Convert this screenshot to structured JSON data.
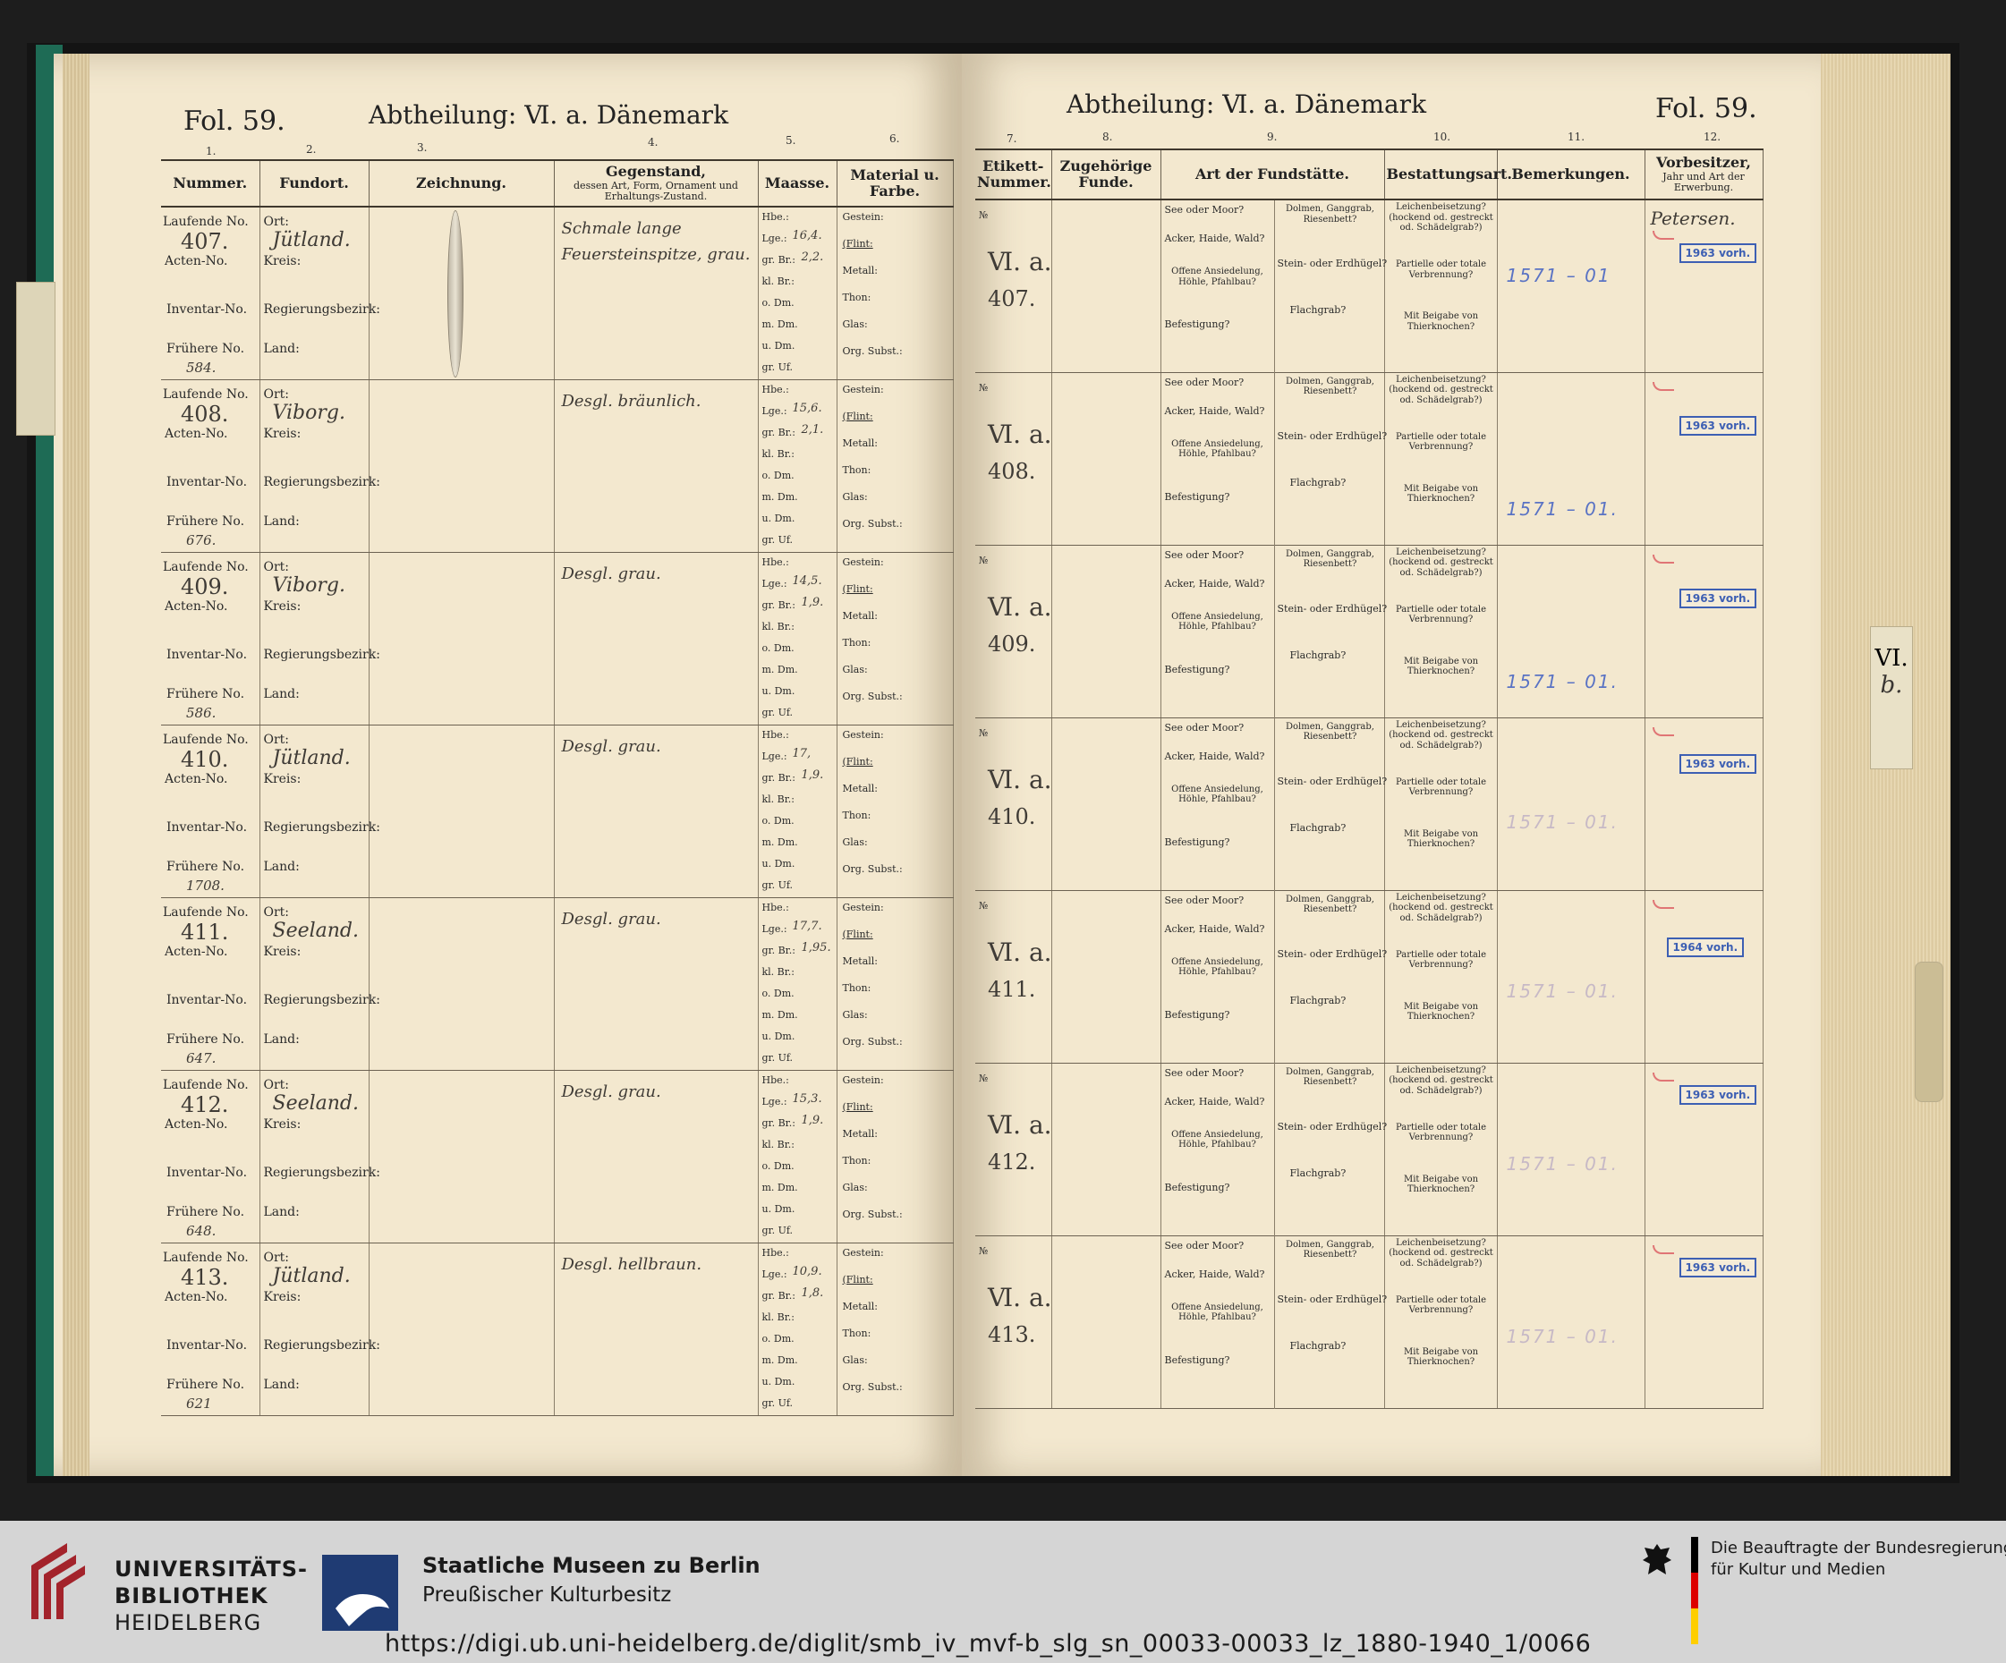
{
  "header": {
    "left_fol": "Fol. 59.",
    "right_fol": "Fol. 59.",
    "left_abth": "Abtheilung: Ⅵ. a. Dänemark",
    "right_abth": "Abtheilung: Ⅵ. a. Dänemark"
  },
  "left_columns": {
    "nums": [
      "1.",
      "2.",
      "3.",
      "4.",
      "5.",
      "6."
    ],
    "nummer": "Nummer.",
    "fundort": "Fundort.",
    "zeichnung": "Zeichnung.",
    "gegenstand": "Gegenstand,",
    "gegenstand_sub": "dessen Art, Form, Ornament und Erhaltungs-Zustand.",
    "maasse": "Maasse.",
    "material": "Material u. Farbe."
  },
  "right_columns": {
    "nums": [
      "7.",
      "8.",
      "9.",
      "10.",
      "11.",
      "12."
    ],
    "etikett": "Etikett-Nummer.",
    "zugehoerige": "Zugehörige Funde.",
    "art": "Art der Fundstätte.",
    "bestattung": "Bestattungsart.",
    "bemerkungen": "Bemerkungen.",
    "vorbesitzer": "Vorbesitzer,",
    "vorbesitzer_sub": "Jahr und Art der Erwerbung."
  },
  "labels": {
    "laufende": "Laufende No.",
    "acten": "Acten-No.",
    "inventar": "Inventar-No.",
    "fruehere": "Frühere No.",
    "ort": "Ort:",
    "kreis": "Kreis:",
    "regierungsbezirk": "Regierungsbezirk:",
    "land": "Land:",
    "hbe": "Hbe.:",
    "lge": "Lge.:",
    "grbr": "gr. Br.:",
    "klbr": "kl. Br.:",
    "odm": "o. Dm.",
    "mdm": "m. Dm.",
    "udm": "u. Dm.",
    "gruf": "gr. Uf.",
    "gestein": "Gestein:",
    "flint": "(Flint:",
    "metall": "Metall:",
    "thon": "Thon:",
    "glas": "Glas:",
    "org": "Org. Subst.:",
    "no": "№",
    "see": "See oder Moor?",
    "acker": "Acker, Haide, Wald?",
    "offene": "Offene Ansiedelung, Höhle, Pfahlbau?",
    "befestigung": "Befestigung?",
    "dolmen": "Dolmen, Ganggrab, Riesenbett?",
    "stein": "Stein- oder Erdhügel?",
    "flachgrab": "Flachgrab?",
    "leichen": "Leichenbeisetzung? (hockend od. gestreckt od. Schädelgrab?)",
    "partielle": "Partielle oder totale Verbrennung?",
    "beigabe": "Mit Beigabe von Thierknochen?"
  },
  "rows": [
    {
      "laufende": "407.",
      "fruehere": "584.",
      "ort": "Jütland.",
      "gegenstand": "Schmale lange Feuersteinspitze, grau.",
      "lge": "16,4.",
      "grbr": "2,2.",
      "etikett_a": "Ⅵ. a.",
      "etikett_b": "407.",
      "pencil": "1571 – 01",
      "stamp": "1963 vorh.",
      "vorbesitzer": "Petersen."
    },
    {
      "laufende": "408.",
      "fruehere": "676.",
      "ort": "Viborg.",
      "gegenstand": "Desgl. bräunlich.",
      "lge": "15,6.",
      "grbr": "2,1.",
      "etikett_a": "Ⅵ. a.",
      "etikett_b": "408.",
      "pencil": "1571 – 01.",
      "stamp": "1963 vorh.",
      "vorbesitzer": ""
    },
    {
      "laufende": "409.",
      "fruehere": "586.",
      "ort": "Viborg.",
      "gegenstand": "Desgl. grau.",
      "lge": "14,5.",
      "grbr": "1,9.",
      "etikett_a": "Ⅵ. a.",
      "etikett_b": "409.",
      "pencil": "1571 – 01.",
      "stamp": "1963 vorh.",
      "vorbesitzer": ""
    },
    {
      "laufende": "410.",
      "fruehere": "1708.",
      "ort": "Jütland.",
      "gegenstand": "Desgl. grau.",
      "lge": "17,",
      "grbr": "1,9.",
      "etikett_a": "Ⅵ. a.",
      "etikett_b": "410.",
      "pencil": "1571 – 01.",
      "stamp": "1963 vorh.",
      "vorbesitzer": ""
    },
    {
      "laufende": "411.",
      "fruehere": "647.",
      "ort": "Seeland.",
      "gegenstand": "Desgl. grau.",
      "lge": "17,7.",
      "grbr": "1,95.",
      "etikett_a": "Ⅵ. a.",
      "etikett_b": "411.",
      "pencil": "1571 – 01.",
      "stamp": "1964 vorh.",
      "vorbesitzer": ""
    },
    {
      "laufende": "412.",
      "fruehere": "648.",
      "ort": "Seeland.",
      "gegenstand": "Desgl. grau.",
      "lge": "15,3.",
      "grbr": "1,9.",
      "etikett_a": "Ⅵ. a.",
      "etikett_b": "412.",
      "pencil": "1571 – 01.",
      "stamp": "1963 vorh.",
      "vorbesitzer": ""
    },
    {
      "laufende": "413.",
      "fruehere": "621",
      "ort": "Jütland.",
      "gegenstand": "Desgl. hellbraun.",
      "lge": "10,9.",
      "grbr": "1,8.",
      "etikett_a": "Ⅵ. a.",
      "etikett_b": "413.",
      "pencil": "1571 – 01.",
      "stamp": "1963 vorh.",
      "vorbesitzer": ""
    }
  ],
  "side_tab": {
    "line1": "VI.",
    "line2": "b."
  },
  "footer": {
    "ub_line1": "UNIVERSITÄTS-",
    "ub_line2": "BIBLIOTHEK",
    "ub_line3": "HEIDELBERG",
    "smb_line1": "Staatliche Museen zu Berlin",
    "smb_line2": "Preußischer Kulturbesitz",
    "bkm_line1": "Die Beauftragte der Bundesregierung",
    "bkm_line2": "für Kultur und Medien",
    "url": "https://digi.ub.uni-heidelberg.de/diglit/smb_iv_mvf-b_slg_sn_00033-00033_lz_1880-1940_1/0066"
  },
  "colors": {
    "stamp": "#3d5fb3",
    "pencil": "#5a73c4",
    "paper": "#f3e8cf",
    "cover": "#1e6b55",
    "smb_blue": "#1f3b73",
    "ub_red": "#a3232b"
  }
}
